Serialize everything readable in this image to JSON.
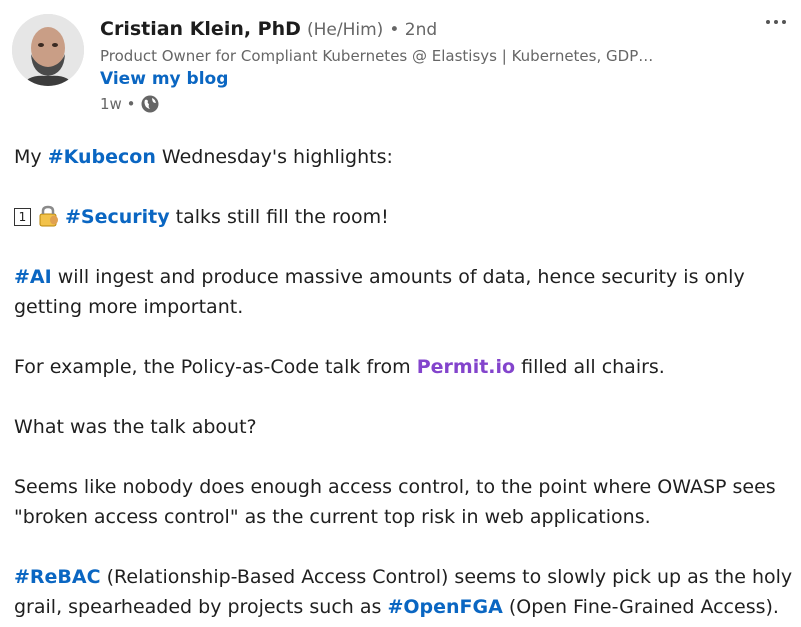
{
  "author": {
    "name": "Cristian Klein, PhD",
    "pronouns": "(He/Him)",
    "degree": "• 2nd",
    "headline": "Product Owner for Compliant Kubernetes @ Elastisys | Kubernetes, GDP…",
    "blog_link": "View my blog",
    "time": "1w •",
    "visibility_icon": "globe-icon"
  },
  "post": {
    "intro_prefix": "My ",
    "intro_tag": "#Kubecon",
    "intro_suffix": " Wednesday's highlights:",
    "item1_number": "1",
    "item1_icon": "lock-icon",
    "item1_tag": "#Security",
    "item1_text": " talks still fill the room!",
    "ai_tag": "#AI",
    "ai_text": " will ingest and produce massive amounts of data, hence security is only getting more important.",
    "example_prefix": "For example, the Policy-as-Code talk from ",
    "example_mention": "Permit.io",
    "example_suffix": " filled all chairs.",
    "question": "What was the talk about?",
    "access_text": "Seems like nobody does enough access control, to the point where OWASP sees \"broken access control\" as the current top risk in web applications.",
    "rebac_tag": "#ReBAC",
    "rebac_text1": " (Relationship-Based Access Control) seems to slowly pick up as the holy grail, spearheaded by projects such as ",
    "openfga_tag": "#OpenFGA",
    "rebac_text2": " (Open Fine-Grained Access)."
  },
  "colors": {
    "hashtag": "#0a66c2",
    "mention": "#8344cc",
    "secondary_text": "#666666"
  }
}
